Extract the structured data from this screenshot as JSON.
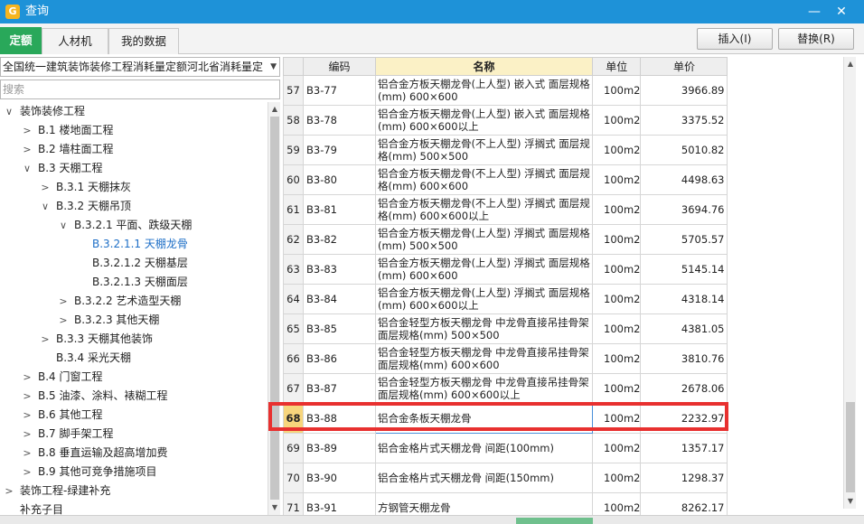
{
  "window": {
    "title": "查询",
    "app_icon": "G"
  },
  "tabs": [
    {
      "label": "定额",
      "active": true
    },
    {
      "label": "人材机",
      "active": false
    },
    {
      "label": "我的数据",
      "active": false
    }
  ],
  "buttons": {
    "insert": "插入(I)",
    "replace": "替换(R)"
  },
  "library": "全国统一建筑装饰装修工程消耗量定额河北省消耗量定",
  "search_placeholder": "搜索",
  "tree": [
    {
      "label": "装饰装修工程",
      "level": 0,
      "toggle": "∨",
      "selected": false
    },
    {
      "label": "B.1 楼地面工程",
      "level": 1,
      "toggle": ">",
      "selected": false
    },
    {
      "label": "B.2 墙柱面工程",
      "level": 1,
      "toggle": ">",
      "selected": false
    },
    {
      "label": "B.3 天棚工程",
      "level": 1,
      "toggle": "∨",
      "selected": false
    },
    {
      "label": "B.3.1 天棚抹灰",
      "level": 2,
      "toggle": ">",
      "selected": false
    },
    {
      "label": "B.3.2 天棚吊顶",
      "level": 2,
      "toggle": "∨",
      "selected": false
    },
    {
      "label": "B.3.2.1 平面、跌级天棚",
      "level": 3,
      "toggle": "∨",
      "selected": false
    },
    {
      "label": "B.3.2.1.1 天棚龙骨",
      "level": 4,
      "toggle": "",
      "selected": true
    },
    {
      "label": "B.3.2.1.2 天棚基层",
      "level": 4,
      "toggle": "",
      "selected": false
    },
    {
      "label": "B.3.2.1.3 天棚面层",
      "level": 4,
      "toggle": "",
      "selected": false
    },
    {
      "label": "B.3.2.2 艺术造型天棚",
      "level": 3,
      "toggle": ">",
      "selected": false
    },
    {
      "label": "B.3.2.3 其他天棚",
      "level": 3,
      "toggle": ">",
      "selected": false
    },
    {
      "label": "B.3.3 天棚其他装饰",
      "level": 2,
      "toggle": ">",
      "selected": false
    },
    {
      "label": "B.3.4 采光天棚",
      "level": 2,
      "toggle": "",
      "selected": false
    },
    {
      "label": "B.4 门窗工程",
      "level": 1,
      "toggle": ">",
      "selected": false
    },
    {
      "label": "B.5 油漆、涂料、裱糊工程",
      "level": 1,
      "toggle": ">",
      "selected": false
    },
    {
      "label": "B.6 其他工程",
      "level": 1,
      "toggle": ">",
      "selected": false
    },
    {
      "label": "B.7 脚手架工程",
      "level": 1,
      "toggle": ">",
      "selected": false
    },
    {
      "label": "B.8 垂直运输及超高增加费",
      "level": 1,
      "toggle": ">",
      "selected": false
    },
    {
      "label": "B.9 其他可竞争措施项目",
      "level": 1,
      "toggle": ">",
      "selected": false
    },
    {
      "label": "装饰工程-绿建补充",
      "level": 0,
      "toggle": ">",
      "selected": false
    },
    {
      "label": "补充子目",
      "level": 0,
      "toggle": "",
      "selected": false
    }
  ],
  "table": {
    "headers": {
      "code": "编码",
      "name": "名称",
      "unit": "单位",
      "price": "单价"
    },
    "rows": [
      {
        "no": "57",
        "code": "B3-77",
        "name": "铝合金方板天棚龙骨(上人型) 嵌入式 面层规格(mm) 600×600",
        "unit": "100m2",
        "price": "3966.89"
      },
      {
        "no": "58",
        "code": "B3-78",
        "name": "铝合金方板天棚龙骨(上人型) 嵌入式 面层规格(mm) 600×600以上",
        "unit": "100m2",
        "price": "3375.52"
      },
      {
        "no": "59",
        "code": "B3-79",
        "name": "铝合金方板天棚龙骨(不上人型) 浮搁式 面层规格(mm) 500×500",
        "unit": "100m2",
        "price": "5010.82"
      },
      {
        "no": "60",
        "code": "B3-80",
        "name": "铝合金方板天棚龙骨(不上人型) 浮搁式 面层规格(mm) 600×600",
        "unit": "100m2",
        "price": "4498.63"
      },
      {
        "no": "61",
        "code": "B3-81",
        "name": "铝合金方板天棚龙骨(不上人型) 浮搁式 面层规格(mm) 600×600以上",
        "unit": "100m2",
        "price": "3694.76"
      },
      {
        "no": "62",
        "code": "B3-82",
        "name": "铝合金方板天棚龙骨(上人型) 浮搁式 面层规格(mm) 500×500",
        "unit": "100m2",
        "price": "5705.57"
      },
      {
        "no": "63",
        "code": "B3-83",
        "name": "铝合金方板天棚龙骨(上人型) 浮搁式 面层规格(mm) 600×600",
        "unit": "100m2",
        "price": "5145.14"
      },
      {
        "no": "64",
        "code": "B3-84",
        "name": "铝合金方板天棚龙骨(上人型) 浮搁式 面层规格(mm) 600×600以上",
        "unit": "100m2",
        "price": "4318.14"
      },
      {
        "no": "65",
        "code": "B3-85",
        "name": "铝合金轻型方板天棚龙骨 中龙骨直接吊挂骨架 面层规格(mm) 500×500",
        "unit": "100m2",
        "price": "4381.05"
      },
      {
        "no": "66",
        "code": "B3-86",
        "name": "铝合金轻型方板天棚龙骨 中龙骨直接吊挂骨架 面层规格(mm) 600×600",
        "unit": "100m2",
        "price": "3810.76"
      },
      {
        "no": "67",
        "code": "B3-87",
        "name": "铝合金轻型方板天棚龙骨 中龙骨直接吊挂骨架 面层规格(mm) 600×600以上",
        "unit": "100m2",
        "price": "2678.06"
      },
      {
        "no": "68",
        "code": "B3-88",
        "name": "铝合金条板天棚龙骨",
        "unit": "100m2",
        "price": "2232.97",
        "current": true
      },
      {
        "no": "69",
        "code": "B3-89",
        "name": "铝合金格片式天棚龙骨 间距(100mm)",
        "unit": "100m2",
        "price": "1357.17"
      },
      {
        "no": "70",
        "code": "B3-90",
        "name": "铝合金格片式天棚龙骨 间距(150mm)",
        "unit": "100m2",
        "price": "1298.37"
      },
      {
        "no": "71",
        "code": "B3-91",
        "name": "方钢管天棚龙骨",
        "unit": "100m2",
        "price": "8262.17"
      }
    ]
  },
  "colors": {
    "titlebar": "#1e92d8",
    "active_tab": "#29a85a",
    "highlight": "#e8302f",
    "name_header": "#fbf1c6"
  }
}
